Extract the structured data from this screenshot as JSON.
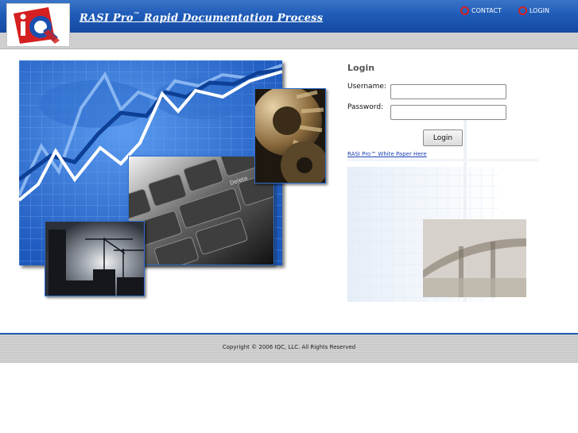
{
  "header": {
    "title": "RASI Pro",
    "title_suffix": " Rapid Documentation Process",
    "trademark": "™",
    "logo_text": "iQ"
  },
  "nav": {
    "contact": "CONTACT",
    "login": "LOGIN"
  },
  "login": {
    "heading": "Login",
    "username_label": "Username:",
    "username_value": "",
    "password_label": "Password:",
    "password_value": "",
    "button_label": "Login",
    "white_paper_link": "RASI Pro™ White Paper Here"
  },
  "footer": {
    "copyright": "Copyright © 2006 IQC, LLC. All Rights Reserved"
  },
  "colors": {
    "header_blue": "#1f5cb8",
    "panel_blue": "#2565c9",
    "logo_red": "#d42020",
    "logo_blue": "#1a4fb0",
    "link_blue": "#1a3fb0"
  },
  "icons": {
    "nav_bullet": "red-ring-icon"
  }
}
